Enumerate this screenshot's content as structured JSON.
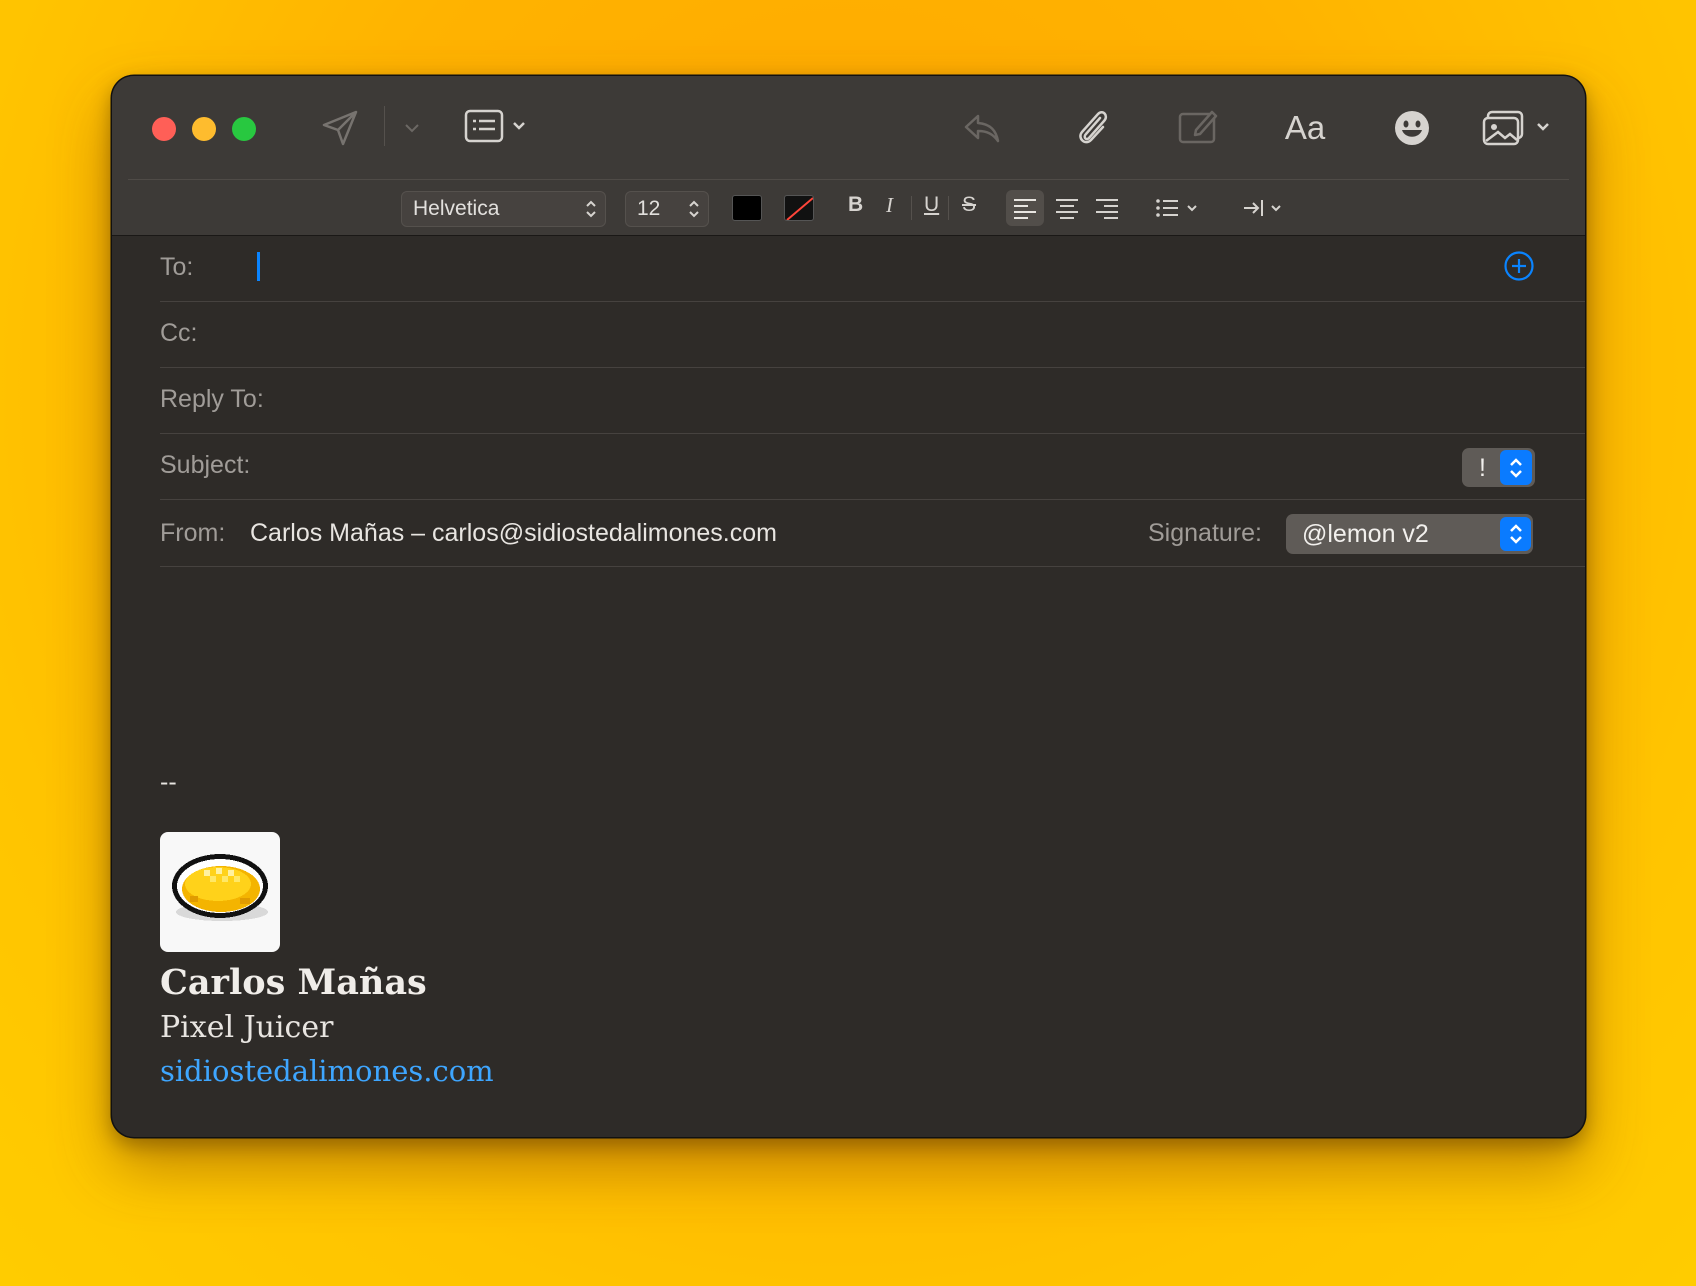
{
  "fonts_popup": {
    "value": "Helvetica"
  },
  "size_popup": {
    "value": "12"
  },
  "format": {
    "bold": "B",
    "italic": "I",
    "underline": "U",
    "strike": "S"
  },
  "toolbar": {
    "format_label": "Aa"
  },
  "fields": {
    "to_label": "To:",
    "cc_label": "Cc:",
    "reply_to_label": "Reply To:",
    "subject_label": "Subject:",
    "priority_label": "!",
    "from_label": "From:",
    "from_value": "Carlos Mañas – carlos@sidiostedalimones.com",
    "signature_label": "Signature:",
    "signature_value": "@lemon v2"
  },
  "body": {
    "separator": "--",
    "sig_name": "Carlos Mañas",
    "sig_title": "Pixel Juicer",
    "sig_link": "sidiostedalimones.com"
  },
  "colors": {
    "accent": "#0a84ff",
    "link": "#3ea6ff",
    "background": "#ffb800",
    "window": "#2e2b28"
  }
}
